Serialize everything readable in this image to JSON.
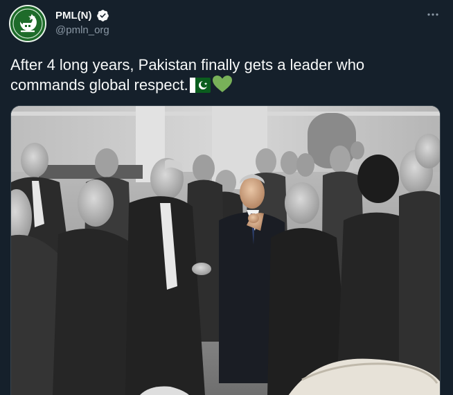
{
  "account": {
    "display_name": "PML(N)",
    "handle": "@pmln_org",
    "avatar_icon": "pmln-party-logo",
    "verified_icon": "verified-badge-icon",
    "verified_color": "#f7f9f9"
  },
  "menu": {
    "icon": "more-options-icon",
    "glyph": "···"
  },
  "tweet": {
    "text": "After 4 long years, Pakistan finally gets a leader who commands global respect.",
    "emojis": [
      "pakistan-flag-emoji",
      "green-heart-emoji"
    ]
  },
  "media": {
    "type": "photo",
    "style": "black-and-white photograph with color splash on one person"
  },
  "colors": {
    "background": "#15202b",
    "text": "#f7f9f9",
    "secondary_text": "#8b98a5",
    "accent_green": "#78b159"
  }
}
